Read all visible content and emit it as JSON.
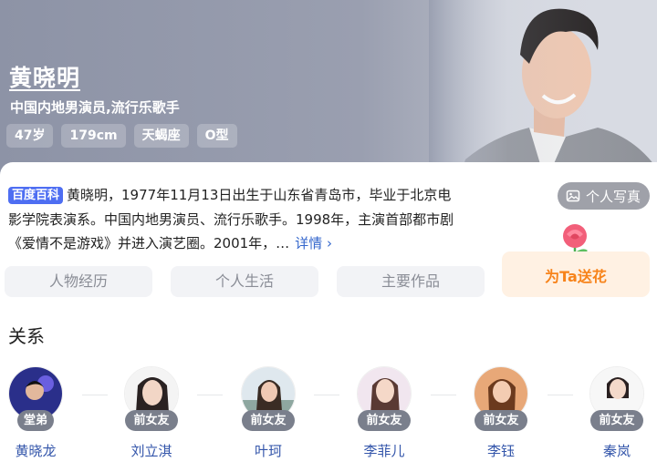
{
  "person": {
    "name": "黄晓明",
    "subtitle": "中国内地男演员,流行乐歌手",
    "tags": [
      "47岁",
      "179cm",
      "天蝎座",
      "O型"
    ],
    "album_label": "个人写真"
  },
  "summary": {
    "badge": "百度百科",
    "text": "黄晓明，1977年11月13日出生于山东省青岛市，毕业于北京电影学院表演系。中国内地男演员、流行乐歌手。1998年，主演首部都市剧《爱情不是游戏》并进入演艺圈。2001年，…",
    "more_label": "详情"
  },
  "nav": [
    "人物经历",
    "个人生活",
    "主要作品"
  ],
  "gift": {
    "label": "为Ta送花"
  },
  "relations": {
    "title": "关系",
    "items": [
      {
        "tag": "堂弟",
        "name": "黄晓龙"
      },
      {
        "tag": "前女友",
        "name": "刘立淇"
      },
      {
        "tag": "前女友",
        "name": "叶珂"
      },
      {
        "tag": "前女友",
        "name": "李菲儿"
      },
      {
        "tag": "前女友",
        "name": "李钰"
      },
      {
        "tag": "前女友",
        "name": "秦岚"
      }
    ]
  },
  "colors": {
    "accent": "#4e6ef2",
    "link": "#3366cc",
    "gift_text": "#f7831a",
    "gift_bg": "#fff1e3"
  }
}
